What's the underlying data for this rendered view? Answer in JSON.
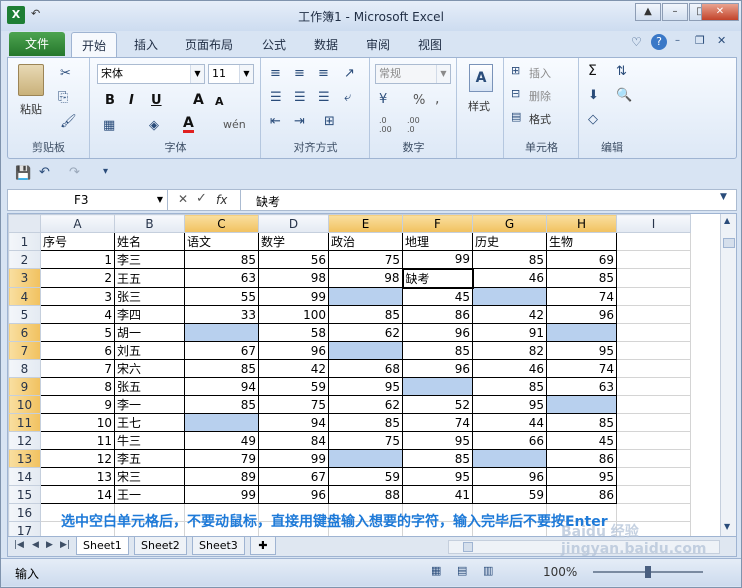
{
  "window": {
    "title": "工作簿1 - Microsoft Excel",
    "app_icon": "X",
    "qat_undo": "↶",
    "qat_redo": "↷"
  },
  "ribbon_tabs": [
    "文件",
    "开始",
    "插入",
    "页面布局",
    "公式",
    "数据",
    "审阅",
    "视图"
  ],
  "ribbon": {
    "clipboard": {
      "paste": "粘贴",
      "label": "剪贴板"
    },
    "font": {
      "name": "宋体",
      "size": "11",
      "bold": "B",
      "italic": "I",
      "underline": "U",
      "grow": "A",
      "shrink": "A",
      "color": "A",
      "phonetic": "wén",
      "label": "字体"
    },
    "alignment": {
      "label": "对齐方式"
    },
    "number": {
      "format": "常规",
      "percent": "%",
      "comma": ",",
      "inc_decimal": ".0 .00",
      "dec_decimal": ".00 .0",
      "label": "数字"
    },
    "styles": {
      "label": "样式"
    },
    "cells": {
      "insert": "插入",
      "delete": "删除",
      "format": "格式",
      "label": "单元格"
    },
    "editing": {
      "sum": "Σ",
      "label": "编辑"
    }
  },
  "formula_bar": {
    "name_box": "F3",
    "fx": "fx",
    "value": "缺考"
  },
  "grid": {
    "columns": [
      "A",
      "B",
      "C",
      "D",
      "E",
      "F",
      "G",
      "H",
      "I"
    ],
    "selected_columns": [
      "C",
      "E",
      "F",
      "G",
      "H"
    ],
    "row_numbers": [
      "1",
      "2",
      "3",
      "4",
      "5",
      "6",
      "7",
      "8",
      "9",
      "10",
      "11",
      "12",
      "13",
      "14",
      "15",
      "16",
      "17"
    ],
    "selected_rows": [
      "3",
      "4",
      "6",
      "7",
      "9",
      "10",
      "11",
      "13"
    ],
    "header": [
      "序号",
      "姓名",
      "语文",
      "数学",
      "政治",
      "地理",
      "历史",
      "生物"
    ],
    "rows": [
      [
        "1",
        "李三",
        "85",
        "56",
        "75",
        "99",
        "85",
        "69"
      ],
      [
        "2",
        "王五",
        "63",
        "98",
        "98",
        "缺考",
        "46",
        "85"
      ],
      [
        "3",
        "张三",
        "55",
        "99",
        "",
        "45",
        "",
        "74"
      ],
      [
        "4",
        "李四",
        "33",
        "100",
        "85",
        "86",
        "42",
        "96"
      ],
      [
        "5",
        "胡一",
        "",
        "58",
        "62",
        "96",
        "91",
        ""
      ],
      [
        "6",
        "刘五",
        "67",
        "96",
        "",
        "85",
        "82",
        "95"
      ],
      [
        "7",
        "宋六",
        "85",
        "42",
        "68",
        "96",
        "46",
        "74"
      ],
      [
        "8",
        "张五",
        "94",
        "59",
        "95",
        "",
        "85",
        "63"
      ],
      [
        "9",
        "李一",
        "85",
        "75",
        "62",
        "52",
        "95",
        ""
      ],
      [
        "10",
        "王七",
        "",
        "94",
        "85",
        "74",
        "44",
        "85"
      ],
      [
        "11",
        "牛三",
        "49",
        "84",
        "75",
        "95",
        "66",
        "45"
      ],
      [
        "12",
        "李五",
        "79",
        "99",
        "",
        "85",
        "",
        "86"
      ],
      [
        "13",
        "宋三",
        "89",
        "67",
        "59",
        "95",
        "96",
        "95"
      ],
      [
        "14",
        "王一",
        "99",
        "96",
        "88",
        "41",
        "59",
        "86"
      ]
    ]
  },
  "instruction_overlay": "选中空白单元格后，不要动鼠标，直接用键盘输入想要的字符，输入完毕后不要按Enter",
  "sheets": [
    "Sheet1",
    "Sheet2",
    "Sheet3"
  ],
  "status_bar": {
    "mode": "输入",
    "zoom": "100%"
  },
  "watermark": "Baidu 经验 jingyan.baidu.com"
}
